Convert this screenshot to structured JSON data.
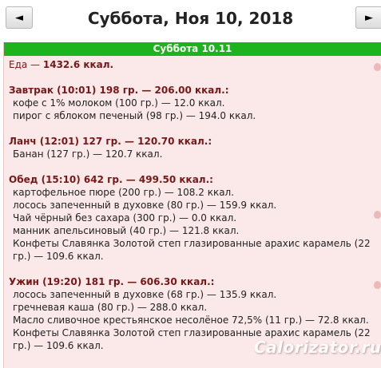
{
  "header": {
    "prev_label": "◄",
    "title": "Суббота, Ноя 10, 2018",
    "next_label": "►"
  },
  "day": {
    "label": "Суббота 10.11",
    "summary_prefix": "Еда — ",
    "summary_total": "1432.6 ккал.",
    "meals": [
      {
        "title": "Завтрак (10:01) 198 гр. — 206.00 ккал.:",
        "items": [
          "кофе с 1% молоком (100 гр.) — 12.0 ккал.",
          "пирог с яблоком печеный (98 гр.) — 194.0 ккал."
        ]
      },
      {
        "title": "Ланч (12:01) 127 гр. — 120.70 ккал.:",
        "items": [
          "Банан (127 гр.) — 120.7 ккал."
        ]
      },
      {
        "title": "Обед (15:10) 642 гр. — 499.50 ккал.:",
        "items": [
          "картофельное пюре (200 гр.) — 108.2 ккал.",
          "лосось запеченный в духовке (80 гр.) — 159.9 ккал.",
          "Чай чёрный без сахара (300 гр.) — 0.0 ккал.",
          "манник апельсиновый (40 гр.) — 121.8 ккал.",
          "Конфеты Славянка Золотой степ глазированные арахис карамель (22 гр.) — 109.6 ккал."
        ]
      },
      {
        "title": "Ужин (19:20) 181 гр. — 606.30 ккал.:",
        "items": [
          "лосось запеченный в духовке (68 гр.) — 135.9 ккал.",
          "гречневая каша (80 гр.) — 288.0 ккал.",
          "Масло сливочное крестьянское несолёное 72,5% (11 гр.) — 72.8 ккал.",
          "Конфеты Славянка Золотой степ глазированные арахис карамель (22 гр.) — 109.6 ккал."
        ]
      }
    ]
  },
  "watermark": "Calorizator.ru",
  "colors": {
    "header_green": "#1db31d",
    "panel_bg": "#fbe9e9",
    "meal_title": "#7a1616"
  }
}
